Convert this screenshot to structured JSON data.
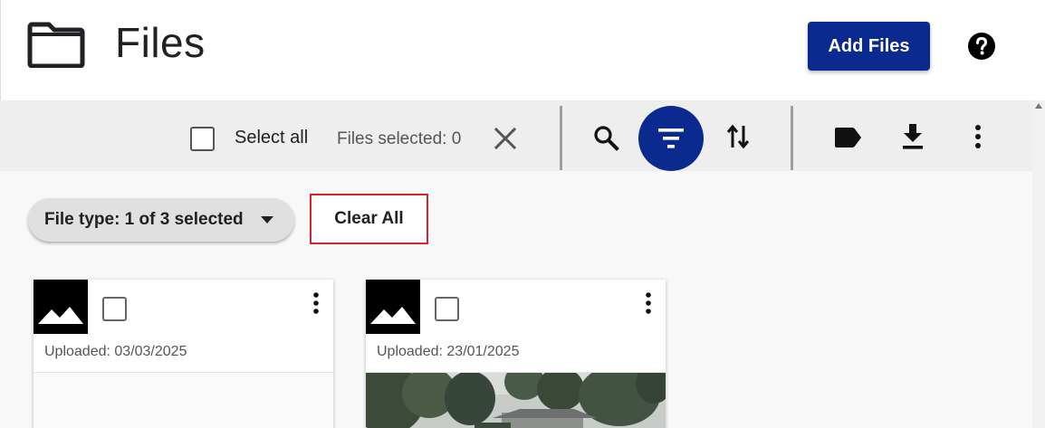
{
  "header": {
    "title": "Files",
    "add_files_label": "Add Files",
    "folder_icon": "folder-icon",
    "help_icon": "help-icon",
    "accent_color": "#0a2a8f"
  },
  "toolbar": {
    "select_all_label": "Select all",
    "files_selected_text": "Files selected: 0",
    "icons": [
      "close-icon",
      "search-icon",
      "filter-icon",
      "sort-icon",
      "label-icon",
      "download-icon",
      "more-vert-icon"
    ],
    "filter_active": true
  },
  "filters": {
    "file_type_chip": "File type: 1 of 3 selected",
    "clear_all_label": "Clear All",
    "highlight_color": "#d8232a"
  },
  "cards": [
    {
      "uploaded": "Uploaded: 03/03/2025",
      "thumbnail": "image-icon",
      "selected": false,
      "preview": "empty"
    },
    {
      "uploaded": "Uploaded: 23/01/2025",
      "thumbnail": "image-icon",
      "selected": false,
      "preview": "photo"
    }
  ]
}
